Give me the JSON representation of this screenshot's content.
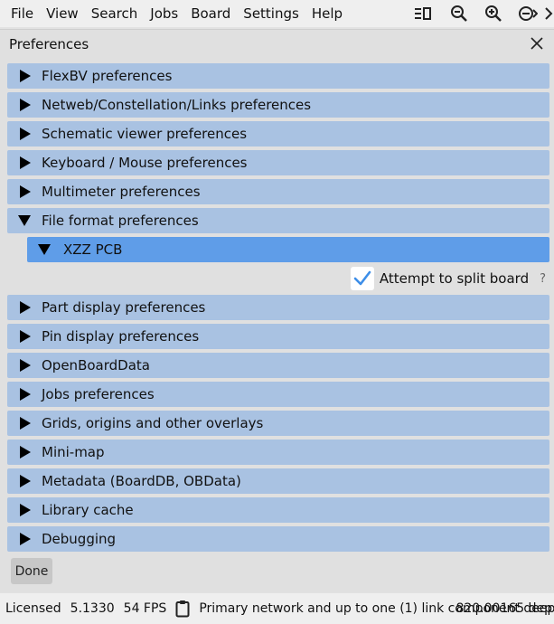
{
  "menubar": {
    "items": [
      "File",
      "View",
      "Search",
      "Jobs",
      "Board",
      "Settings",
      "Help"
    ],
    "icons": [
      "layers-panel-icon",
      "zoom-out-icon",
      "zoom-in-icon",
      "zoom-fit-icon",
      "chevron-icon"
    ]
  },
  "dialog": {
    "title": "Preferences",
    "sections": [
      "FlexBV preferences",
      "Netweb/Constellation/Links preferences",
      "Schematic viewer preferences",
      "Keyboard / Mouse preferences",
      "Multimeter preferences",
      "File format preferences",
      "Part display preferences",
      "Pin display preferences",
      "OpenBoardData",
      "Jobs preferences",
      "Grids, origins and other overlays",
      "Mini-map",
      "Metadata (BoardDB, OBData)",
      "Library cache",
      "Debugging"
    ],
    "expanded_section_index": 5,
    "subsection": {
      "label": "XZZ PCB",
      "option_label": "Attempt to split board",
      "option_checked": true,
      "help": "?"
    },
    "done_label": "Done"
  },
  "statusbar": {
    "license": "Licensed",
    "version": "5.1330",
    "fps": "54 FPS",
    "message": "Primary network and up to one (1) link component deep",
    "right_value": "820.00165 dep"
  },
  "colors": {
    "section_bg": "#a9c2e2",
    "subsection_bg": "#5f9de8",
    "checkmark": "#3d8ee8",
    "dialog_bg": "#e0e0e0"
  }
}
